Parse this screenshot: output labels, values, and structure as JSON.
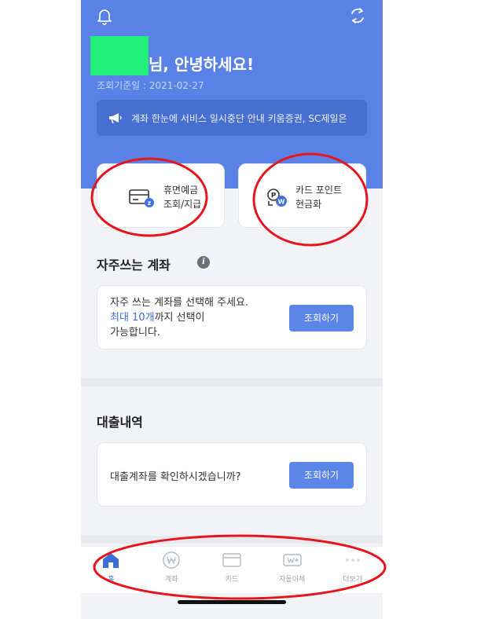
{
  "header": {
    "greeting": "님, 안녕하세요!",
    "date_label": "조회기준일 : 2021-02-27",
    "notice": "계좌 한눈에 서비스 일시중단 안내 키움증권, SC제일은"
  },
  "quick_actions": [
    {
      "line1": "휴면예금",
      "line2": "조회/지급",
      "icon": "dormant-deposit-icon"
    },
    {
      "line1": "카드 포인트",
      "line2": "현금화",
      "icon": "card-point-cash-icon"
    }
  ],
  "favorites": {
    "title": "자주쓰는 계좌",
    "line1": "자주 쓰는 계좌를 선택해 주세요.",
    "line2_blue": "최대 10개",
    "line2_rest": "까지 선택이",
    "line3": "가능합니다.",
    "button": "조회하기"
  },
  "loans": {
    "title": "대출내역",
    "text": "대출계좌를 확인하시겠습니까?",
    "button": "조회하기"
  },
  "tabs": [
    {
      "label": "홈",
      "icon": "home-icon",
      "active": true
    },
    {
      "label": "계좌",
      "icon": "account-won-icon",
      "active": false
    },
    {
      "label": "카드",
      "icon": "card-icon",
      "active": false
    },
    {
      "label": "자동이체",
      "icon": "auto-transfer-icon",
      "active": false
    },
    {
      "label": "더보기",
      "icon": "more-icon",
      "active": false
    }
  ],
  "colors": {
    "header_blue": "#5a82e6",
    "button_blue": "#5b86e8",
    "annotation_red": "#e8141c",
    "redaction_green": "#22ee7a"
  }
}
